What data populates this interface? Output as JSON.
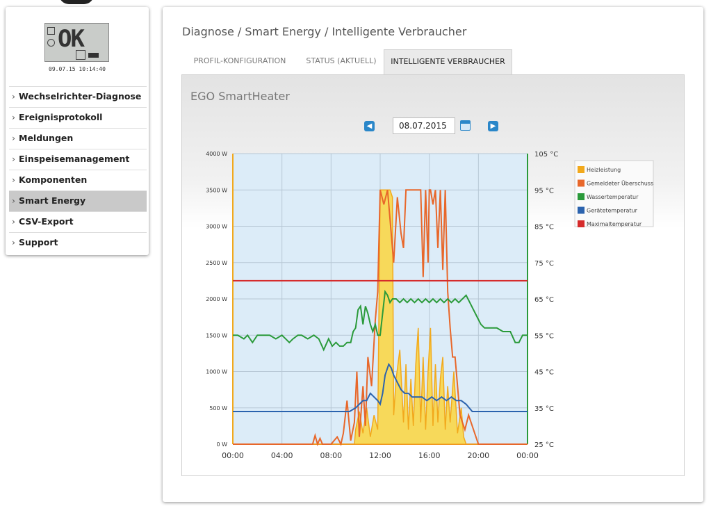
{
  "lcd": {
    "display": "OK",
    "timestamp": "09.07.15 10:14:40"
  },
  "sidebar": {
    "items": [
      {
        "label": "Wechselrichter-Diagnose",
        "arrow": "›"
      },
      {
        "label": "Ereignisprotokoll",
        "arrow": "›"
      },
      {
        "label": "Meldungen",
        "arrow": "›"
      },
      {
        "label": "Einspeisemanagement",
        "arrow": "›"
      },
      {
        "label": "Komponenten",
        "arrow": "›"
      },
      {
        "label": "Smart Energy",
        "arrow": "›",
        "active": true
      },
      {
        "label": "CSV-Export",
        "arrow": "›"
      },
      {
        "label": "Support",
        "arrow": "›"
      }
    ]
  },
  "breadcrumb": "Diagnose / Smart Energy / Intelligente Verbraucher",
  "tabs": [
    {
      "label": "PROFIL-KONFIGURATION"
    },
    {
      "label": "STATUS (AKTUELL)"
    },
    {
      "label": "INTELLIGENTE VERBRAUCHER",
      "active": true
    }
  ],
  "panel": {
    "title": "EGO SmartHeater"
  },
  "date_picker": {
    "value": "08.07.2015",
    "prev_icon": "arrow-left-icon",
    "next_icon": "arrow-right-icon",
    "calendar_icon": "calendar-icon"
  },
  "chart_data": {
    "type": "line",
    "x_ticks": [
      "00:00",
      "04:00",
      "08:00",
      "12:00",
      "16:00",
      "20:00",
      "00:00"
    ],
    "x_range_hours": [
      0,
      24
    ],
    "y_left": {
      "unit": "W",
      "range": [
        0,
        4000
      ],
      "ticks": [
        "0 W",
        "500 W",
        "1000 W",
        "1500 W",
        "2000 W",
        "2500 W",
        "3000 W",
        "3500 W",
        "4000 W"
      ]
    },
    "y_right": {
      "unit": "°C",
      "range": [
        25,
        105
      ],
      "ticks": [
        "25 °C",
        "35 °C",
        "45 °C",
        "55 °C",
        "65 °C",
        "75 °C",
        "85 °C",
        "95 °C",
        "105 °C"
      ]
    },
    "grid": true,
    "legend_position": "right",
    "series": [
      {
        "name": "Heizleistung",
        "color": "#f2a91c",
        "axis": "left",
        "style": "area",
        "x": [
          0,
          9.9,
          10.0,
          10.3,
          10.6,
          10.9,
          11.2,
          11.5,
          11.8,
          12.0,
          12.1,
          12.2,
          12.5,
          12.8,
          13.0,
          13.1,
          13.3,
          13.6,
          13.9,
          14.1,
          14.3,
          14.5,
          14.7,
          14.9,
          15.1,
          15.3,
          15.5,
          15.7,
          15.9,
          16.1,
          16.3,
          16.5,
          16.7,
          16.9,
          17.1,
          17.3,
          17.5,
          17.7,
          18.0,
          18.3,
          18.6,
          18.8,
          19.0,
          24
        ],
        "y": [
          0,
          0,
          200,
          450,
          150,
          500,
          100,
          400,
          200,
          3500,
          3500,
          3500,
          3500,
          3500,
          3400,
          400,
          900,
          1300,
          300,
          1100,
          200,
          900,
          250,
          1100,
          1600,
          300,
          1200,
          200,
          1000,
          1600,
          250,
          1100,
          300,
          900,
          1200,
          200,
          800,
          300,
          1000,
          150,
          500,
          100,
          0,
          0
        ]
      },
      {
        "name": "Gemeldeter Überschuss",
        "color": "#e8672a",
        "axis": "left",
        "style": "line",
        "x": [
          0,
          6.5,
          6.7,
          6.9,
          7.1,
          7.3,
          8.0,
          8.5,
          8.8,
          9.0,
          9.3,
          9.6,
          9.9,
          10.1,
          10.3,
          10.6,
          10.8,
          11.0,
          11.3,
          11.6,
          11.8,
          12.0,
          12.3,
          12.6,
          12.9,
          13.1,
          13.4,
          13.7,
          13.9,
          14.1,
          14.3,
          14.5,
          14.7,
          14.9,
          15.1,
          15.3,
          15.5,
          15.7,
          15.9,
          16.0,
          16.1,
          16.3,
          16.5,
          16.7,
          16.9,
          17.1,
          17.3,
          17.5,
          17.7,
          17.9,
          18.1,
          18.3,
          18.5,
          18.7,
          18.9,
          19.2,
          19.6,
          20.0,
          24
        ],
        "y": [
          0,
          0,
          120,
          0,
          80,
          0,
          0,
          100,
          0,
          150,
          600,
          50,
          300,
          1000,
          100,
          800,
          250,
          1200,
          800,
          1700,
          2100,
          3500,
          3300,
          3500,
          2900,
          2500,
          3400,
          2900,
          2700,
          3500,
          3500,
          3500,
          3500,
          3500,
          3500,
          3500,
          2300,
          3500,
          2500,
          3500,
          3500,
          3300,
          3500,
          2700,
          3500,
          2400,
          3500,
          2100,
          1600,
          1200,
          1200,
          800,
          400,
          300,
          200,
          400,
          200,
          0,
          0
        ]
      },
      {
        "name": "Wassertemperatur",
        "color": "#2a9a3a",
        "axis": "right",
        "style": "line",
        "x": [
          0,
          0.4,
          0.9,
          1.2,
          1.6,
          2.0,
          2.5,
          3.0,
          3.5,
          4.0,
          4.3,
          4.6,
          4.9,
          5.3,
          5.6,
          6.1,
          6.6,
          7.0,
          7.4,
          7.8,
          8.1,
          8.4,
          8.7,
          9.0,
          9.3,
          9.6,
          9.8,
          10.0,
          10.2,
          10.4,
          10.6,
          10.8,
          11.0,
          11.2,
          11.4,
          11.6,
          11.8,
          12.0,
          12.2,
          12.4,
          12.6,
          12.8,
          13.0,
          13.3,
          13.6,
          13.9,
          14.2,
          14.5,
          14.8,
          15.1,
          15.4,
          15.7,
          16.0,
          16.3,
          16.6,
          16.9,
          17.2,
          17.5,
          17.8,
          18.1,
          18.4,
          18.7,
          19.0,
          19.3,
          19.6,
          19.9,
          20.2,
          20.5,
          21.0,
          21.5,
          22.0,
          22.3,
          22.6,
          23.0,
          23.3,
          23.6,
          24
        ],
        "y": [
          55,
          55,
          54,
          55,
          53,
          55,
          55,
          55,
          54,
          55,
          54,
          53,
          54,
          55,
          55,
          54,
          55,
          54,
          51,
          54,
          52,
          53,
          52,
          52,
          53,
          53,
          56,
          57,
          62,
          63,
          58,
          63,
          61,
          58,
          56,
          58,
          55,
          55,
          61,
          67,
          66,
          64,
          65,
          65,
          64,
          65,
          64,
          65,
          64,
          65,
          64,
          65,
          64,
          65,
          64,
          65,
          64,
          65,
          64,
          65,
          64,
          65,
          66,
          64,
          62,
          60,
          58,
          57,
          57,
          57,
          56,
          56,
          56,
          53,
          53,
          55,
          55
        ]
      },
      {
        "name": "Gerätetemperatur",
        "color": "#2b63ae",
        "axis": "right",
        "style": "line",
        "x": [
          0,
          9.5,
          10.0,
          10.3,
          10.6,
          10.9,
          11.2,
          11.5,
          11.8,
          12.0,
          12.2,
          12.4,
          12.7,
          12.9,
          13.1,
          13.4,
          13.7,
          14.0,
          14.3,
          14.6,
          15.0,
          15.4,
          15.8,
          16.2,
          16.6,
          17.0,
          17.4,
          17.8,
          18.2,
          18.6,
          19.0,
          19.5,
          20.0,
          21.0,
          22.0,
          23.0,
          24
        ],
        "y": [
          34,
          34,
          35,
          36,
          37,
          37,
          39,
          38,
          37,
          36,
          39,
          44,
          47,
          46,
          44,
          42,
          40,
          39,
          39,
          38,
          38,
          38,
          37,
          38,
          37,
          38,
          37,
          38,
          37,
          37,
          36,
          34,
          34,
          34,
          34,
          34,
          34
        ]
      },
      {
        "name": "Maximaltemperatur",
        "color": "#d62b2b",
        "axis": "right",
        "style": "line",
        "x": [
          0,
          24
        ],
        "y": [
          70,
          70
        ]
      }
    ]
  }
}
